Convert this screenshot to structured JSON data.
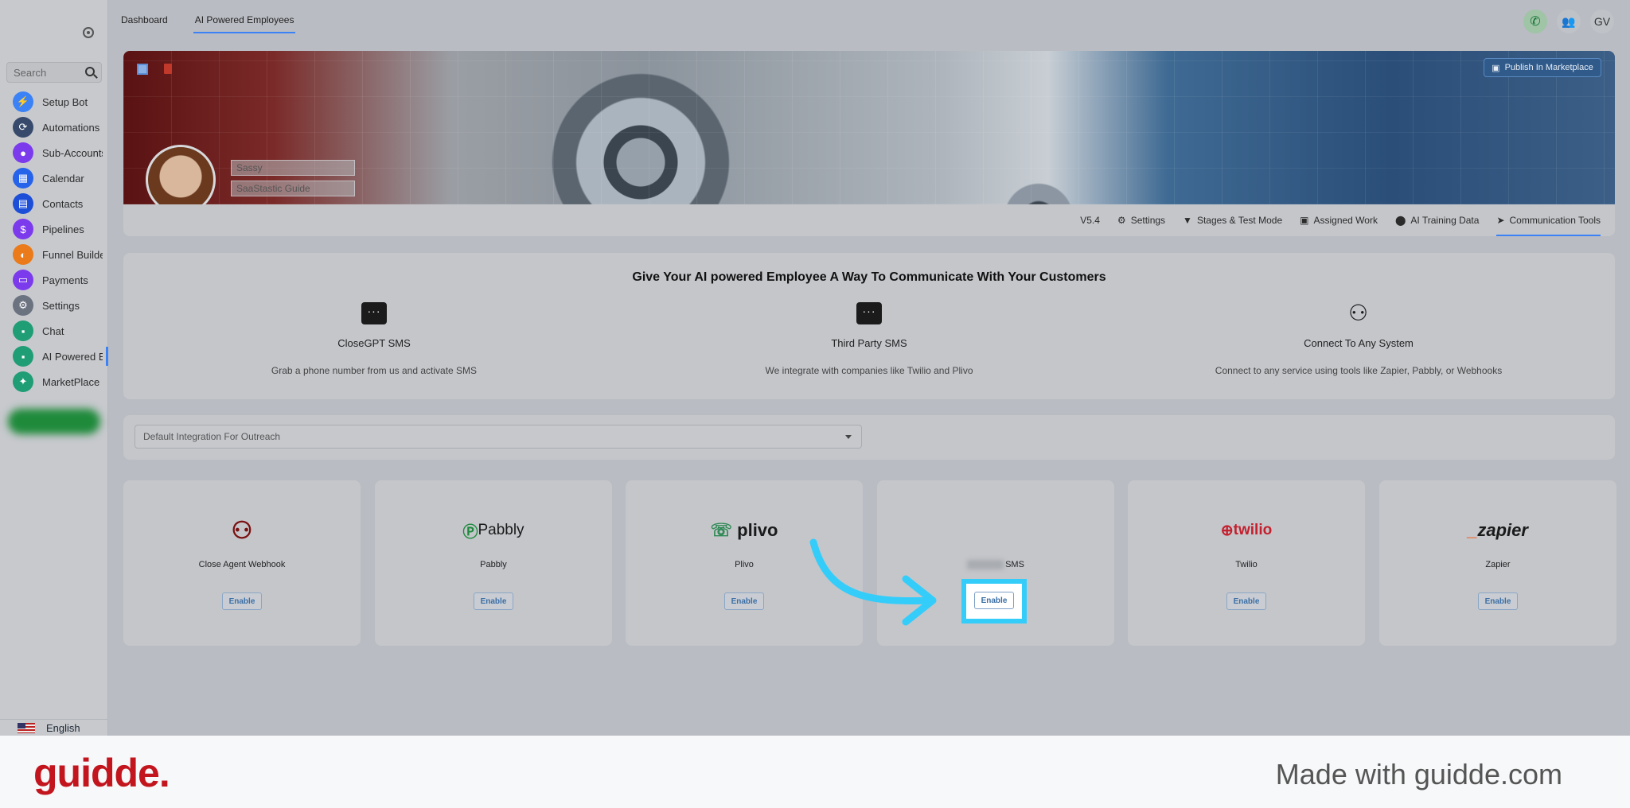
{
  "sidebar": {
    "search_placeholder": "Search",
    "items": [
      {
        "label": "Setup Bot",
        "icon": "bolt-icon",
        "color": "#3b82f6",
        "glyph": "⚡"
      },
      {
        "label": "Automations",
        "icon": "automation-icon",
        "color": "#374a6b",
        "glyph": "⟳"
      },
      {
        "label": "Sub-Accounts",
        "icon": "user-icon",
        "color": "#7c3aed",
        "glyph": "●"
      },
      {
        "label": "Calendar",
        "icon": "calendar-icon",
        "color": "#2563eb",
        "glyph": "▦"
      },
      {
        "label": "Contacts",
        "icon": "contacts-icon",
        "color": "#1d4ed8",
        "glyph": "▤"
      },
      {
        "label": "Pipelines",
        "icon": "dollar-icon",
        "color": "#7c3aed",
        "glyph": "$"
      },
      {
        "label": "Funnel Builder",
        "icon": "funnel-icon",
        "color": "#ea7a1a",
        "glyph": "◐"
      },
      {
        "label": "Payments",
        "icon": "card-icon",
        "color": "#7c3aed",
        "glyph": "▭"
      },
      {
        "label": "Settings",
        "icon": "gear-icon",
        "color": "#6b7280",
        "glyph": "⚙"
      },
      {
        "label": "Chat",
        "icon": "chat-icon",
        "color": "#1f9d74",
        "glyph": "▪"
      },
      {
        "label": "AI Powered Employees",
        "icon": "ai-chat-icon",
        "color": "#1f9d74",
        "glyph": "▪"
      },
      {
        "label": "MarketPlace",
        "icon": "marketplace-icon",
        "color": "#1f9d74",
        "glyph": "✦"
      }
    ],
    "language": "English"
  },
  "topnav": {
    "tabs": [
      "Dashboard",
      "AI Powered Employees"
    ],
    "avatar_initials": "GV"
  },
  "banner": {
    "publish_label": "Publish In Marketplace",
    "name_value": "Sassy",
    "subtitle_value": "SaaStastic Guide"
  },
  "profile_tabs": {
    "version": "V5.4",
    "items": [
      "Settings",
      "Stages & Test Mode",
      "Assigned Work",
      "AI Training Data",
      "Communication Tools"
    ]
  },
  "communication": {
    "title": "Give Your AI powered Employee A Way To Communicate With Your Customers",
    "features": [
      {
        "title": "CloseGPT SMS",
        "desc": "Grab a phone number from us and activate SMS"
      },
      {
        "title": "Third Party SMS",
        "desc": "We integrate with companies like Twilio and Plivo"
      },
      {
        "title": "Connect To Any System",
        "desc": "Connect to any service using tools like Zapier, Pabbly, or Webhooks"
      }
    ]
  },
  "dropdown": {
    "value": "Default Integration For Outreach"
  },
  "integrations": [
    {
      "name": "Close Agent Webhook",
      "logo": "",
      "enable": "Enable"
    },
    {
      "name": "Pabbly",
      "logo": "Pabbly",
      "enable": "Enable"
    },
    {
      "name": "Plivo",
      "logo": "plivo",
      "enable": "Enable"
    },
    {
      "name": "SMS",
      "logo": "",
      "enable": "Enable"
    },
    {
      "name": "Twilio",
      "logo": "twilio",
      "enable": "Enable"
    },
    {
      "name": "Zapier",
      "logo": "zapier",
      "enable": "Enable"
    }
  ],
  "footer": {
    "brand": "guidde.",
    "made_with": "Made with guidde.com"
  },
  "colors": {
    "accent": "#3b82f6",
    "highlight": "#34cdfa",
    "brand_red": "#c3151e"
  }
}
